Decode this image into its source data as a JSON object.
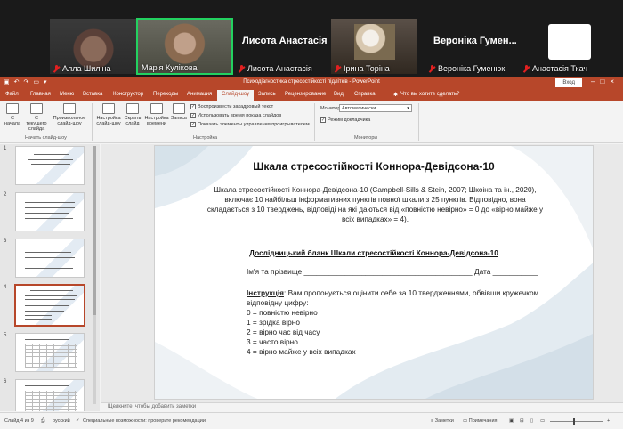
{
  "zoom": {
    "participants": [
      {
        "name": "Алла Шиліна"
      },
      {
        "name": "Марія Кулікова"
      },
      {
        "name": "Лисота Анастасія"
      },
      {
        "name": "Ірина Торіна"
      },
      {
        "name": "Вероніка Гуменюк"
      },
      {
        "name": "Анастасія Ткач"
      }
    ],
    "big_names": [
      "Лисота Анастасія",
      "Вероніка Гумен..."
    ],
    "active_speaker_color": "#23d160",
    "muted_color": "#e02020"
  },
  "app": {
    "title": "Психодіагностика стресостійкості підлітків - PowerPoint",
    "sign_in": "Вход",
    "accent": "#b7472a"
  },
  "tabs": [
    "Файл",
    "Главная",
    "Меню",
    "Вставка",
    "Конструктор",
    "Переходы",
    "Анимация",
    "Слайд-шоу",
    "Запись",
    "Рецензирование",
    "Вид",
    "Справка"
  ],
  "active_tab": "Слайд-шоу",
  "tell_me": "Что вы хотите сделать?",
  "ribbon": {
    "start": {
      "from_start": "С начала",
      "from_current": "С текущего слайда",
      "present_online": "Произвольное слайд-шоу",
      "label": "Начать слайд-шоу"
    },
    "setup": {
      "setup_show": "Настройка слайд-шоу",
      "hide_slide": "Скрыть слайд",
      "rehearse": "Настройка времени",
      "record": "Запись",
      "play_narrations": "Воспроизвести закадровый текст",
      "use_timings": "Использовать время показа слайдов",
      "show_media_controls": "Показать элементы управления проигрывателем",
      "label": "Настройка"
    },
    "monitors": {
      "monitor_label": "Монитор:",
      "monitor_value": "Автоматически",
      "presenter_view": "Режим докладчика",
      "label": "Мониторы"
    }
  },
  "thumbnails": [
    "1",
    "2",
    "3",
    "4",
    "5",
    "6"
  ],
  "active_slide": "4",
  "slide": {
    "title": "Шкала стресостійкості Коннора-Девідсона-10",
    "intro": "Шкала стресостійкості Коннора-Девідсона-10 (Campbell-Sills & Stein, 2007; Шкоіна та ін., 2020), включає 10 найбільш інформативних пунктів повної шкали з 25 пунктів. Відповідно, вона складається з 10 тверджень, відповіді на які даються від «повністю невірно» = 0 до «вірно майже у всіх випадках» = 4).",
    "form_title": "Дослідницький бланк Шкали стресостійкості Коннора-Девідсона-10",
    "name_line": "Ім'я та прізвище _________________________________________ Дата ___________",
    "instruction_label": "Інструкція",
    "instruction": ": Вам пропонується оцінити себе за 10 твердженнями, обвівши кружечком відповідну цифру:",
    "items": [
      "0 = повністю невірно",
      "1 = зрідка вірно",
      "2 = вірно час від часу",
      "3 = часто вірно",
      "4 = вірно майже у всіх випадках"
    ]
  },
  "notes_placeholder": "Щелкните, чтобы добавить заметки",
  "status": {
    "slide_info": "Слайд 4 из 9",
    "language": "русский",
    "accessibility": "Специальные возможности: проверьте рекомендации",
    "notes": "Заметки",
    "comments": "Примечания"
  }
}
